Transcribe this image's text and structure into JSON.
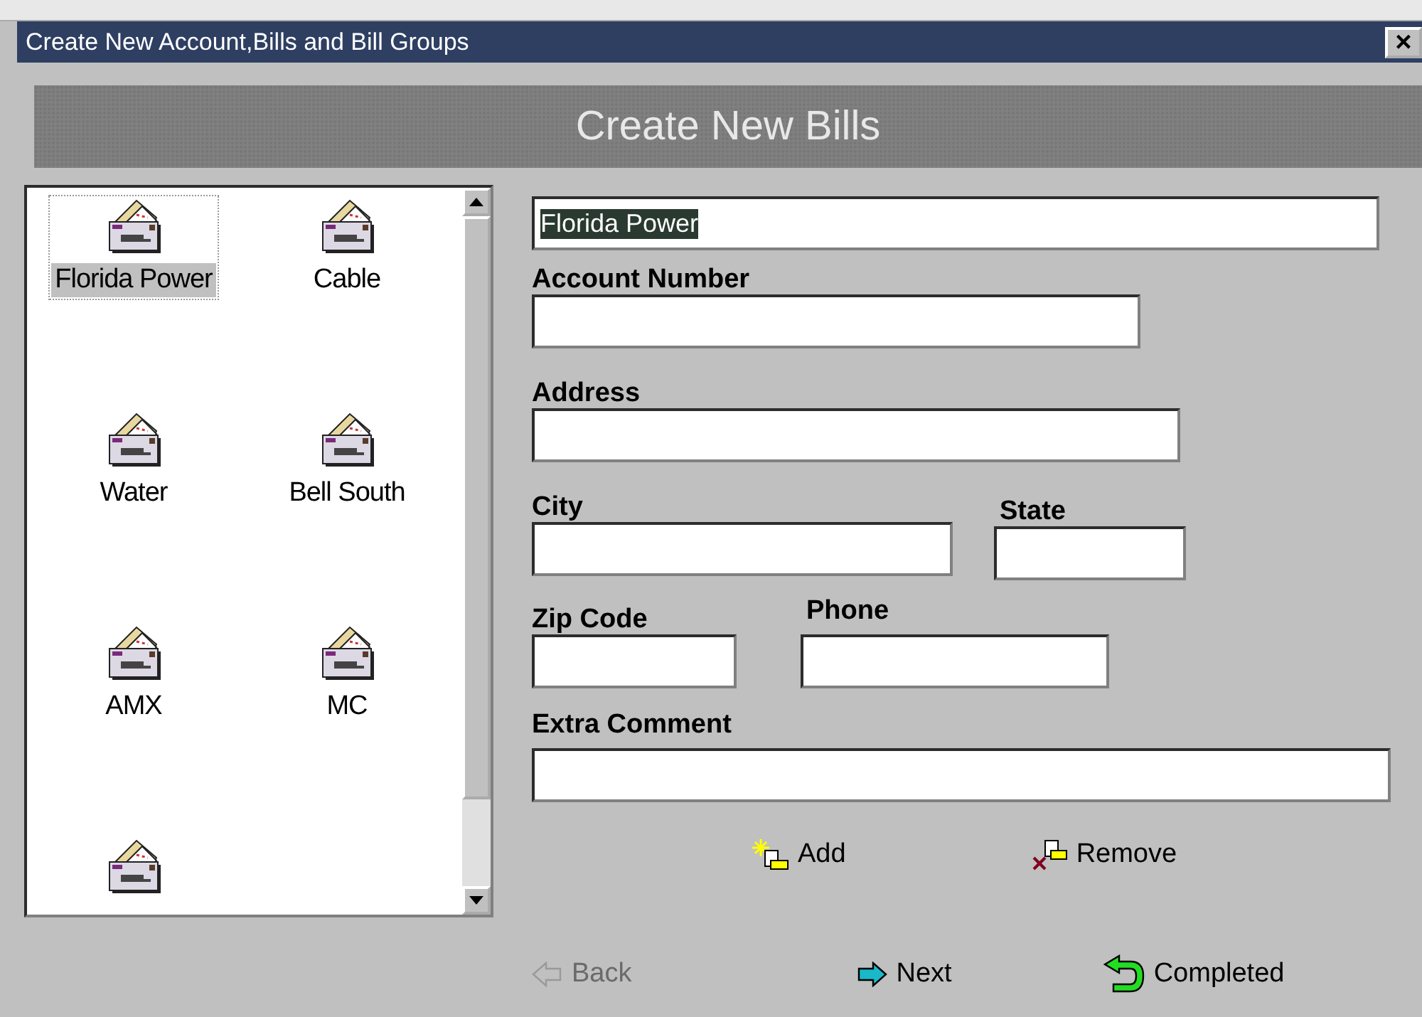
{
  "window": {
    "title": "Create New Account,Bills and Bill Groups",
    "close": "×"
  },
  "banner": {
    "title": "Create New Bills"
  },
  "bill_list": {
    "items": [
      {
        "label": "Florida Power",
        "selected": true
      },
      {
        "label": "Cable",
        "selected": false
      },
      {
        "label": "Water",
        "selected": false
      },
      {
        "label": "Bell South",
        "selected": false
      },
      {
        "label": "AMX",
        "selected": false
      },
      {
        "label": "MC",
        "selected": false
      },
      {
        "selected": false
      }
    ]
  },
  "form": {
    "name_field": {
      "value": "Florida Power",
      "selected": true
    },
    "fields": [
      {
        "label": "Account Number"
      },
      {
        "label": "Address"
      },
      {
        "label": "City"
      },
      {
        "label": "State"
      },
      {
        "label": "Zip Code"
      },
      {
        "label": "Phone"
      },
      {
        "label": "Extra Comment"
      }
    ]
  },
  "actions": [
    {
      "label": "Add",
      "kind": "add"
    },
    {
      "label": "Remove",
      "kind": "remove"
    }
  ],
  "nav_buttons": [
    {
      "label": "Back",
      "kind": "back",
      "disabled": true
    },
    {
      "label": "Next",
      "kind": "next",
      "disabled": false
    },
    {
      "label": "Completed",
      "kind": "completed",
      "disabled": false
    }
  ]
}
